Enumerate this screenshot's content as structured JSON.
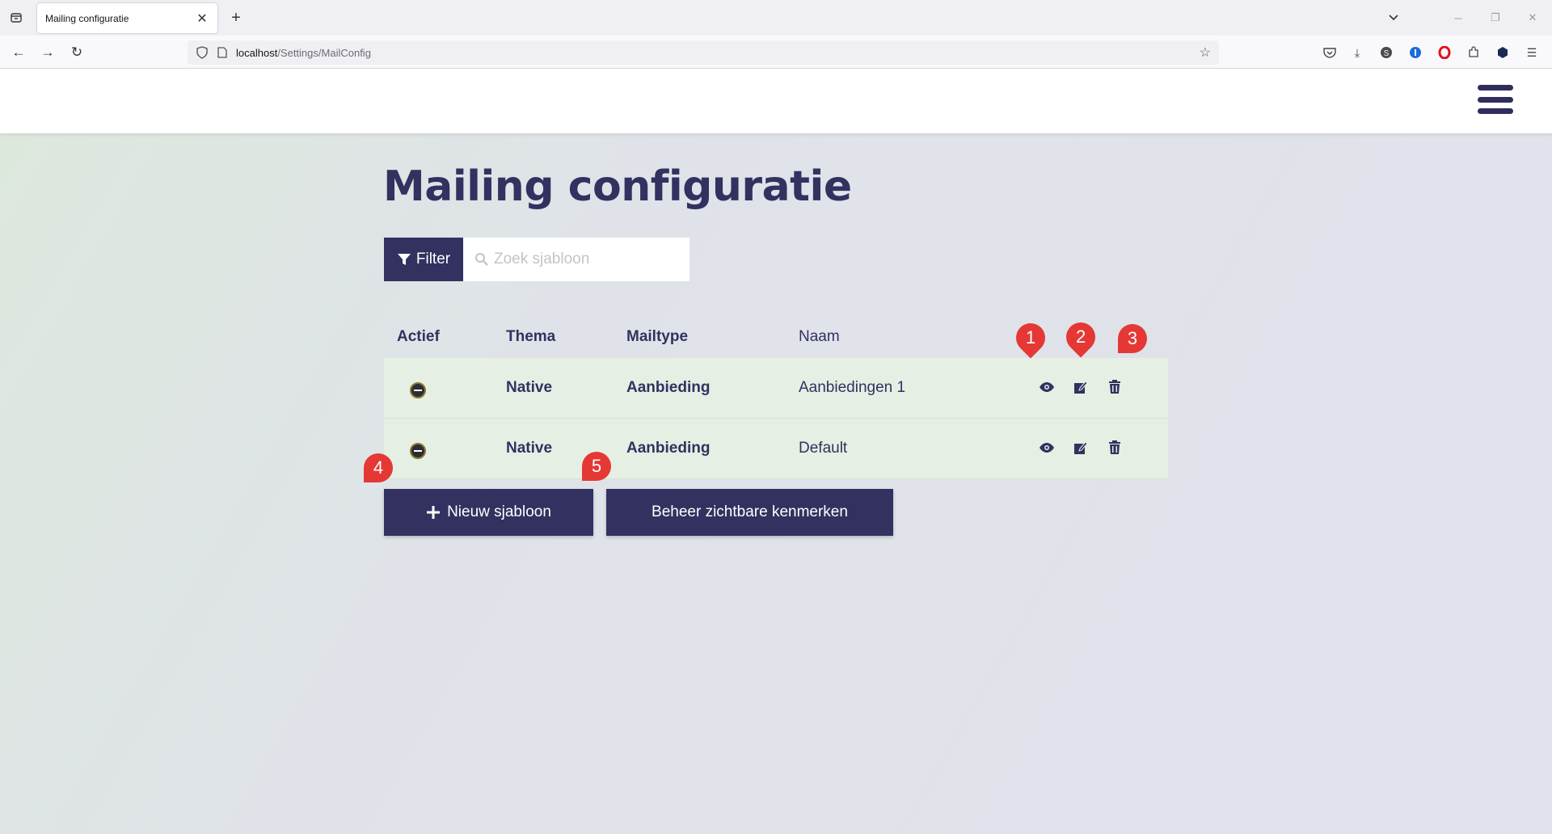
{
  "browser": {
    "tab_title": "Mailing configuratie",
    "url_host": "localhost",
    "url_path": "/Settings/MailConfig"
  },
  "page": {
    "title": "Mailing configuratie",
    "filter_label": "Filter",
    "search_placeholder": "Zoek sjabloon"
  },
  "table": {
    "headers": [
      "Actief",
      "Thema",
      "Mailtype",
      "Naam"
    ],
    "rows": [
      {
        "thema": "Native",
        "mailtype": "Aanbieding",
        "naam": "Aanbiedingen 1"
      },
      {
        "thema": "Native",
        "mailtype": "Aanbieding",
        "naam": "Default"
      }
    ]
  },
  "buttons": {
    "new_template": "Nieuw sjabloon",
    "manage_attributes": "Beheer zichtbare kenmerken"
  },
  "markers": [
    "1",
    "2",
    "3",
    "4",
    "5"
  ],
  "colors": {
    "primary": "#333160",
    "row_bg": "#e5efe3",
    "marker": "#e53835"
  }
}
